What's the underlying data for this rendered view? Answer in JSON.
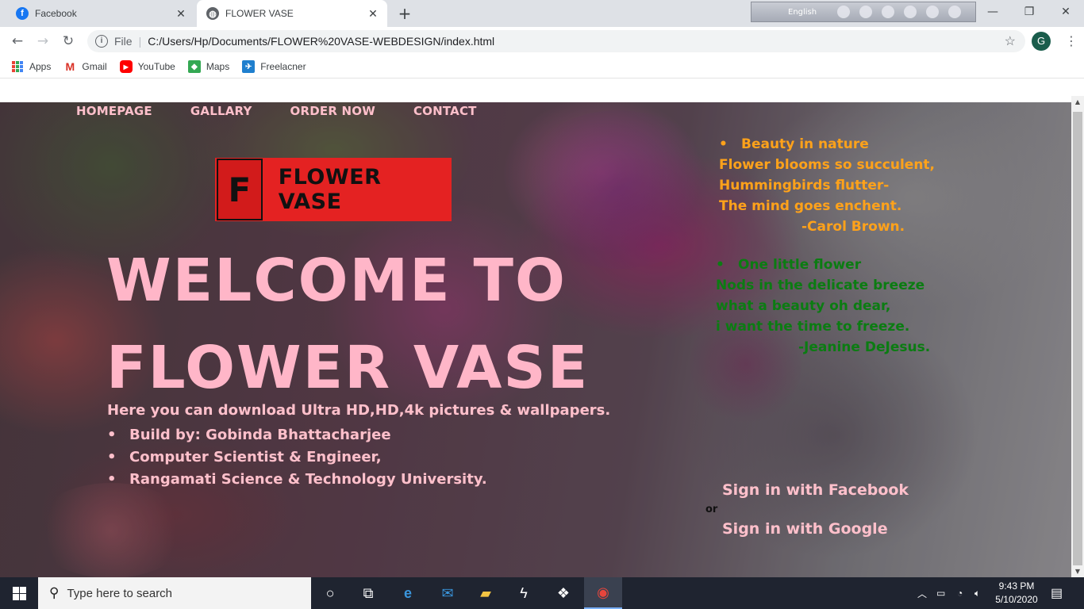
{
  "browser": {
    "tabs": [
      {
        "title": "Facebook",
        "favicon": "facebook-icon",
        "active": false
      },
      {
        "title": "FLOWER VASE",
        "favicon": "globe-icon",
        "active": true
      }
    ],
    "new_tab": "+",
    "language_bar": {
      "label": "English"
    },
    "window_controls": {
      "minimize": "—",
      "maximize": "❐",
      "close": "✕"
    },
    "address": {
      "scheme_label": "File",
      "url": "C:/Users/Hp/Documents/FLOWER%20VASE-WEBDESIGN/index.html"
    },
    "profile_initial": "G",
    "bookmarks": [
      {
        "label": "Apps",
        "icon": "apps-grid-icon"
      },
      {
        "label": "Gmail",
        "icon": "gmail-icon"
      },
      {
        "label": "YouTube",
        "icon": "youtube-icon"
      },
      {
        "label": "Maps",
        "icon": "maps-icon"
      },
      {
        "label": "Freelacner",
        "icon": "freelancer-icon"
      }
    ]
  },
  "site": {
    "nav": [
      "HOMEPAGE",
      "GALLARY",
      "ORDER NOW",
      "CONTACT"
    ],
    "logo": {
      "letter": "F",
      "text": "FLOWER VASE"
    },
    "welcome_line1": "WELCOME TO",
    "welcome_line2": "FLOWER VASE",
    "description": "Here you can download Ultra HD,HD,4k pictures & wallpapers.",
    "credits": [
      "Build by: Gobinda Bhattacharjee",
      "Computer Scientist & Engineer,",
      "Rangamati Science & Technology University."
    ],
    "poem1": {
      "title": "Beauty in nature",
      "lines": [
        "Flower blooms so succulent,",
        "Hummingbirds flutter-",
        "The mind goes enchent."
      ],
      "author": "-Carol Brown."
    },
    "poem2": {
      "title": "One little flower",
      "lines": [
        "Nods in the delicate breeze",
        "what a beauty oh dear,",
        "i want the time to freeze."
      ],
      "author": "-Jeanine DeJesus."
    },
    "signin_facebook": "Sign in with Facebook",
    "or_text": "or",
    "signin_google": "Sign in with Google",
    "colors": {
      "pink": "#ffc0cb",
      "orange": "#ffa21a",
      "green": "#0b7c12",
      "logo_red": "#e42222"
    }
  },
  "taskbar": {
    "search_placeholder": "Type here to search",
    "time": "9:43 PM",
    "date": "5/10/2020"
  }
}
